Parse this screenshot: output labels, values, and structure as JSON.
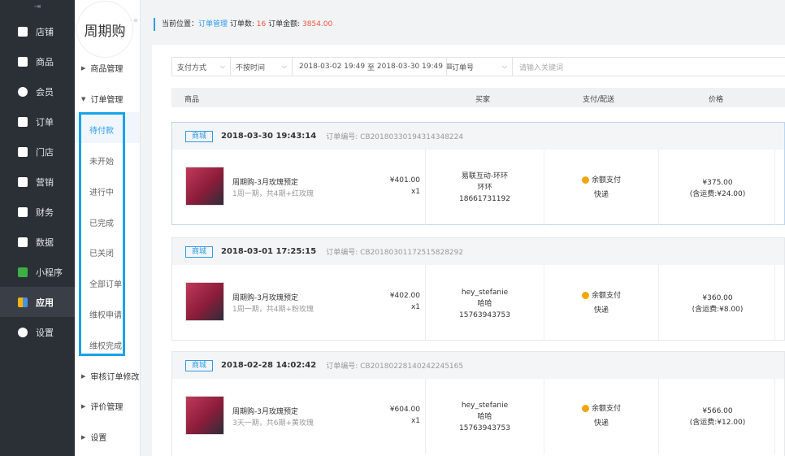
{
  "nav": {
    "collapse_icon": "⇥",
    "items": [
      {
        "label": "店铺",
        "icon": "store-icon"
      },
      {
        "label": "商品",
        "icon": "goods-icon"
      },
      {
        "label": "会员",
        "icon": "member-icon"
      },
      {
        "label": "订单",
        "icon": "order-icon"
      },
      {
        "label": "门店",
        "icon": "shop-icon"
      },
      {
        "label": "营销",
        "icon": "marketing-icon"
      },
      {
        "label": "财务",
        "icon": "finance-icon"
      },
      {
        "label": "数据",
        "icon": "chart-icon"
      },
      {
        "label": "小程序",
        "icon": "miniprogram-icon"
      },
      {
        "label": "应用",
        "icon": "apps-icon"
      },
      {
        "label": "设置",
        "icon": "gear-icon"
      }
    ],
    "active_index": 9
  },
  "sub": {
    "logo_text": "周期购",
    "collapse_icon": "«",
    "groups": {
      "goods": "商品管理",
      "orders": "订单管理",
      "review_edit": "审核订单修改",
      "comments": "评价管理",
      "settings": "设置"
    },
    "order_items": [
      "待付款",
      "未开始",
      "进行中",
      "已完成",
      "已关闭",
      "全部订单",
      "维权申请",
      "维权完成"
    ],
    "active_item": 0
  },
  "breadcrumb": {
    "prefix": "当前位置：",
    "link": "订单管理",
    "count_label": " 订单数: ",
    "count": "16",
    "amount_label": " 订单金额: ",
    "amount": "3854.00"
  },
  "filter": {
    "payment": "支付方式",
    "time": "不按时间",
    "date_start": "2018-03-02 19:49",
    "date_sep": "至",
    "date_end": "2018-03-30 19:49",
    "field": "订单号",
    "keyword_placeholder": "请输入关键词"
  },
  "table_headers": {
    "goods": "商品",
    "buyer": "买家",
    "payment": "支付/配送",
    "price": "价格"
  },
  "orders": [
    {
      "tag": "商城",
      "date": "2018-03-30  19:43:14",
      "order_no": "订单编号: CB20180330194314348224",
      "product_name": "周期购-3月玫瑰预定",
      "product_desc": "1周一期，共4期+红玫瑰",
      "unit_price": "¥401.00",
      "qty": "x1",
      "buyer_name": "易联互动-环环",
      "buyer_nick": "环环",
      "buyer_phone": "18661731192",
      "pay_method": "余额支付",
      "delivery": "快递",
      "total": "¥375.00",
      "shipping": "(含运费:¥24.00)"
    },
    {
      "tag": "商城",
      "date": "2018-03-01  17:25:15",
      "order_no": "订单编号: CB20180301172515828292",
      "product_name": "周期购-3月玫瑰预定",
      "product_desc": "1周一期，共4期+粉玫瑰",
      "unit_price": "¥402.00",
      "qty": "x1",
      "buyer_name": "hey_stefanie",
      "buyer_nick": "哈哈",
      "buyer_phone": "15763943753",
      "pay_method": "余额支付",
      "delivery": "快递",
      "total": "¥360.00",
      "shipping": "(含运费:¥8.00)"
    },
    {
      "tag": "商城",
      "date": "2018-02-28  14:02:42",
      "order_no": "订单编号: CB20180228140242245165",
      "product_name": "周期购-3月玫瑰预定",
      "product_desc": "3天一期，共6期+黄玫瑰",
      "unit_price": "¥604.00",
      "qty": "x1",
      "buyer_name": "hey_stefanie",
      "buyer_nick": "哈哈",
      "buyer_phone": "15763943753",
      "pay_method": "余额支付",
      "delivery": "快递",
      "total": "¥566.00",
      "shipping": "(含运费:¥12.00)"
    }
  ],
  "colors": {
    "accent": "#2f9bea",
    "highlight_box": "#1aa3e8",
    "nav_bg": "#2b2f36",
    "amount_red": "#e8553b"
  }
}
